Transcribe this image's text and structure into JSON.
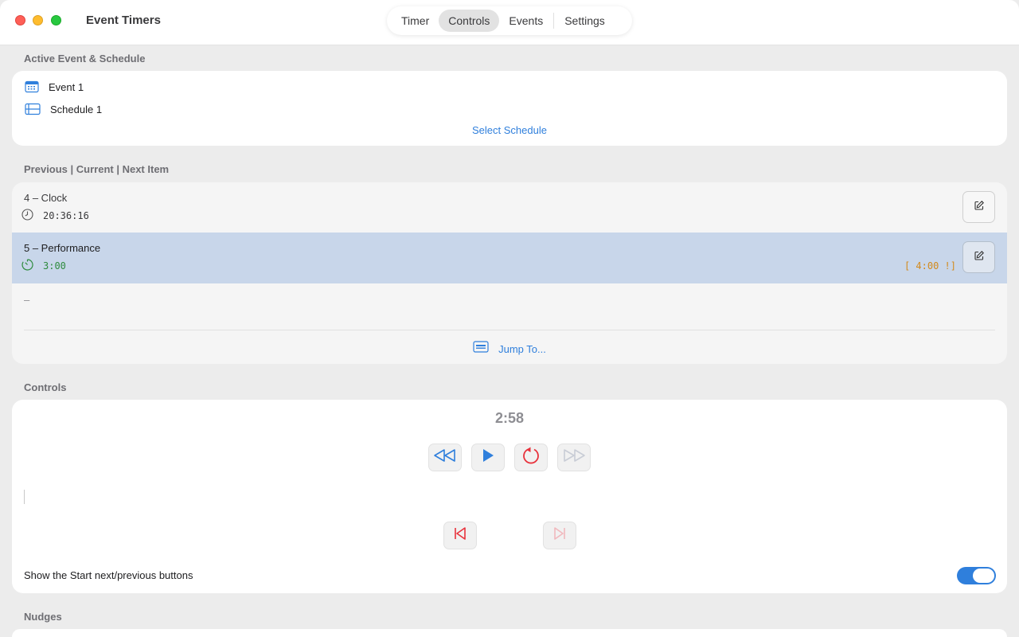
{
  "window": {
    "title": "Event Timers",
    "tabs": [
      {
        "label": "Timer",
        "active": false
      },
      {
        "label": "Controls",
        "active": true
      },
      {
        "label": "Events",
        "active": false
      },
      {
        "label": "Settings",
        "active": false
      }
    ]
  },
  "active_section": {
    "label": "Active Event & Schedule",
    "event_name": "Event 1",
    "schedule_name": "Schedule 1",
    "select_schedule_label": "Select Schedule",
    "event_icon": "calendar-icon",
    "schedule_icon": "list-icon"
  },
  "items_section": {
    "label": "Previous | Current | Next Item",
    "previous": {
      "title": "4 – Clock",
      "time": "20:36:16",
      "icon": "clock-icon"
    },
    "current": {
      "title": "5 – Performance",
      "time": "3:00",
      "overrun": "[ 4:00 !]",
      "icon": "timer-icon"
    },
    "next": {
      "title": "–"
    },
    "jump_label": "Jump To...",
    "jump_icon": "list-box-icon"
  },
  "controls_section": {
    "label": "Controls",
    "timer": "2:58",
    "show_start_buttons_label": "Show the Start next/previous buttons",
    "show_start_buttons_enabled": true,
    "colors": {
      "accent": "#2f7fdc",
      "red": "#e8323c",
      "disabled": "#c9cdd6",
      "warn": "#d38a1c"
    }
  },
  "nudges_section": {
    "label": "Nudges"
  }
}
